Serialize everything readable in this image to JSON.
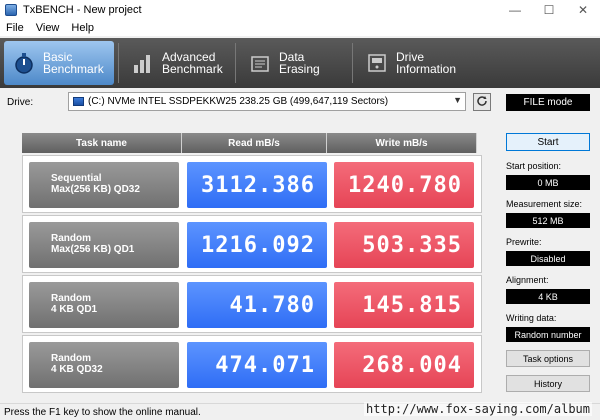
{
  "window": {
    "title": "TxBENCH - New project",
    "min_glyph": "—",
    "max_glyph": "☐",
    "close_glyph": "✕"
  },
  "menu": [
    "File",
    "View",
    "Help"
  ],
  "tabs": [
    {
      "line1": "Basic",
      "line2": "Benchmark",
      "icon": "stopwatch-icon",
      "active": true
    },
    {
      "line1": "Advanced",
      "line2": "Benchmark",
      "icon": "bar-chart-icon",
      "active": false
    },
    {
      "line1": "Data Erasing",
      "line2": "",
      "icon": "eraser-icon",
      "active": false
    },
    {
      "line1": "Drive",
      "line2": "Information",
      "icon": "drive-info-icon",
      "active": false
    }
  ],
  "drive": {
    "label": "Drive:",
    "selected": "(C:) NVMe INTEL SSDPEKKW25  238.25 GB (499,647,119 Sectors)",
    "mode": "FILE mode"
  },
  "table": {
    "headers": [
      "Task name",
      "Read mB/s",
      "Write mB/s"
    ],
    "rows": [
      {
        "task1": "Sequential",
        "task2": "Max(256 KB) QD32",
        "read": "3112.386",
        "write": "1240.780"
      },
      {
        "task1": "Random",
        "task2": "Max(256 KB) QD1",
        "read": "1216.092",
        "write": "503.335"
      },
      {
        "task1": "Random",
        "task2": "4 KB QD1",
        "read": "41.780",
        "write": "145.815"
      },
      {
        "task1": "Random",
        "task2": "4 KB QD32",
        "read": "474.071",
        "write": "268.004"
      }
    ]
  },
  "panel": {
    "start": "Start",
    "start_position_label": "Start position:",
    "start_position": "0 MB",
    "measurement_size_label": "Measurement size:",
    "measurement_size": "512 MB",
    "prewrite_label": "Prewrite:",
    "prewrite": "Disabled",
    "alignment_label": "Alignment:",
    "alignment": "4 KB",
    "writing_data_label": "Writing data:",
    "writing_data": "Random number",
    "task_options": "Task options",
    "history": "History"
  },
  "status": "Press the F1 key to show the online manual.",
  "watermark": "http://www.fox-saying.com/album",
  "colors": {
    "read": "#3d7ef8",
    "write": "#ec5566",
    "task": "#858585",
    "active_tab": "#6aa4de"
  }
}
